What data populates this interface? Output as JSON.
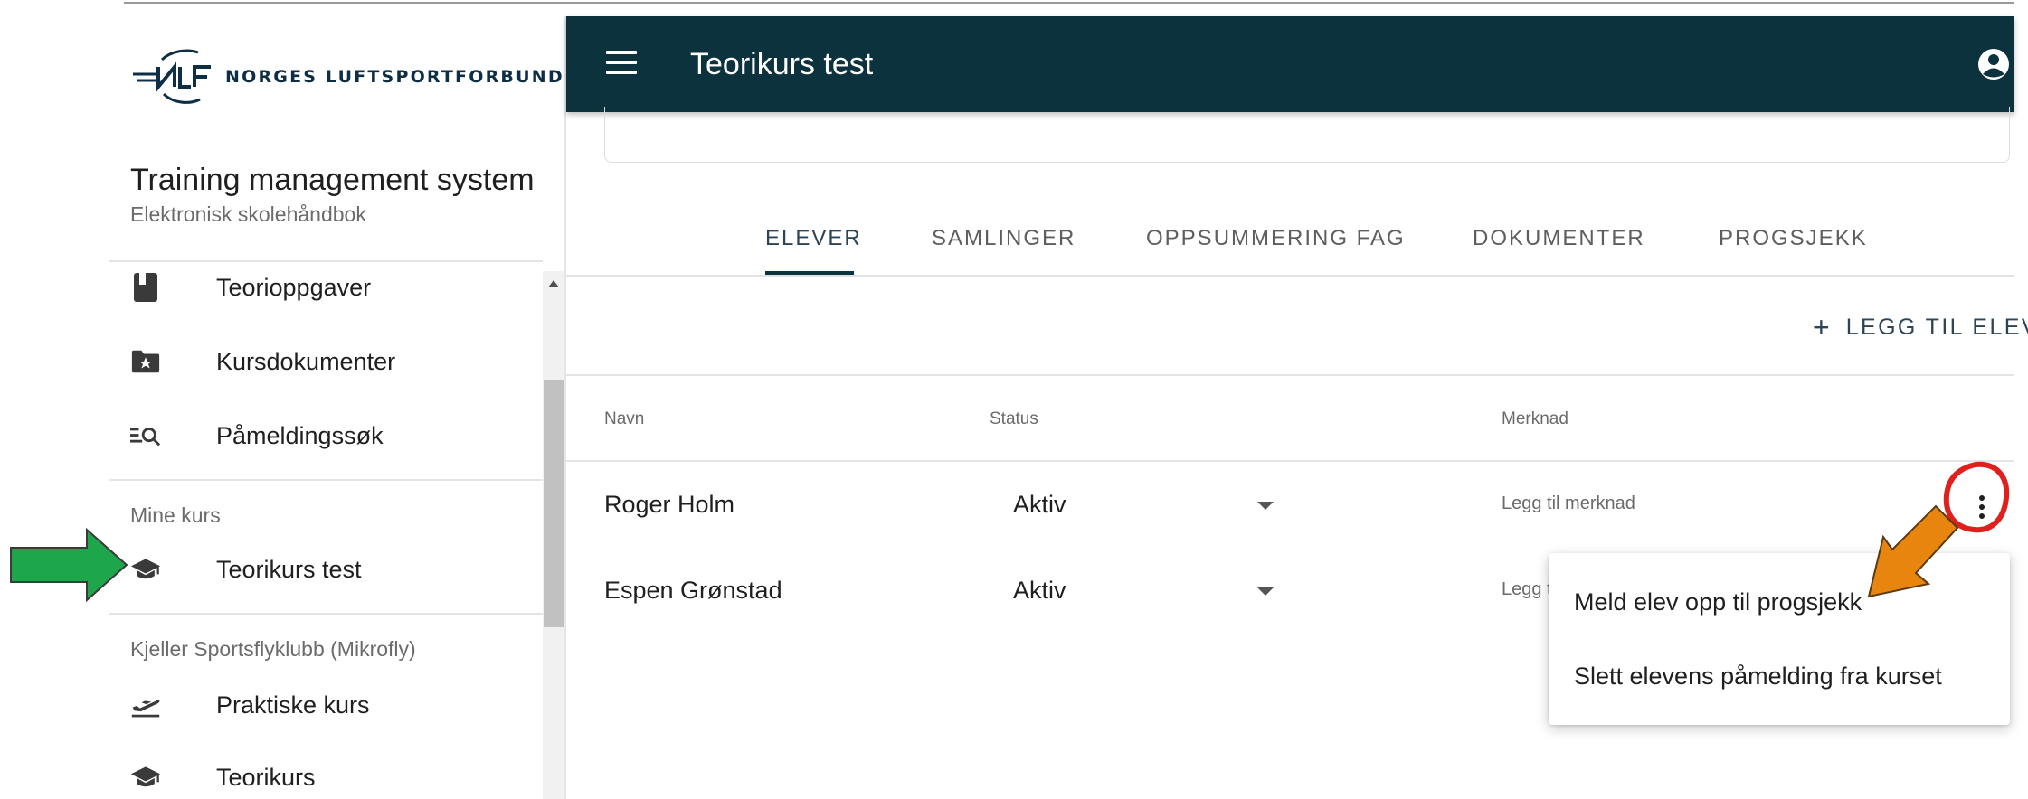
{
  "brand": {
    "logo_text": "NORGES LUFTSPORTFORBUND"
  },
  "sidebar": {
    "app_title": "Training management system",
    "app_subtitle": "Elektronisk skolehåndbok",
    "items": [
      {
        "label": "Teorioppgaver",
        "icon": "book-icon"
      },
      {
        "label": "Kursdokumenter",
        "icon": "folder-star-icon"
      },
      {
        "label": "Påmeldingssøk",
        "icon": "list-search-icon"
      }
    ],
    "my_courses": {
      "label": "Mine kurs",
      "items": [
        {
          "label": "Teorikurs test",
          "icon": "school-icon"
        }
      ]
    },
    "club": {
      "label": "Kjeller Sportsflyklubb  (Mikrofly)",
      "items": [
        {
          "label": "Praktiske kurs",
          "icon": "flight-takeoff-icon"
        },
        {
          "label": "Teorikurs",
          "icon": "school-icon"
        }
      ]
    }
  },
  "header": {
    "title": "Teorikurs test"
  },
  "tabs": [
    {
      "label": "ELEVER",
      "active": true
    },
    {
      "label": "SAMLINGER"
    },
    {
      "label": "OPPSUMMERING FAG"
    },
    {
      "label": "DOKUMENTER"
    },
    {
      "label": "PROGSJEKK"
    }
  ],
  "actions": {
    "add_student": "LEGG TIL ELEV"
  },
  "table": {
    "columns": [
      "Navn",
      "Status",
      "Merknad"
    ],
    "rows": [
      {
        "name": "Roger Holm",
        "status": "Aktiv",
        "note": "Legg til merknad"
      },
      {
        "name": "Espen Grønstad",
        "status": "Aktiv",
        "note": "Legg t"
      }
    ]
  },
  "context_menu": {
    "items": [
      "Meld elev opp til progsjekk",
      "Slett elevens påmelding fra kurset"
    ]
  },
  "colors": {
    "appbar": "#0c323e",
    "green_arrow": "#1ea64a",
    "orange_arrow": "#e8850f",
    "red_annotation": "#e0201c"
  }
}
